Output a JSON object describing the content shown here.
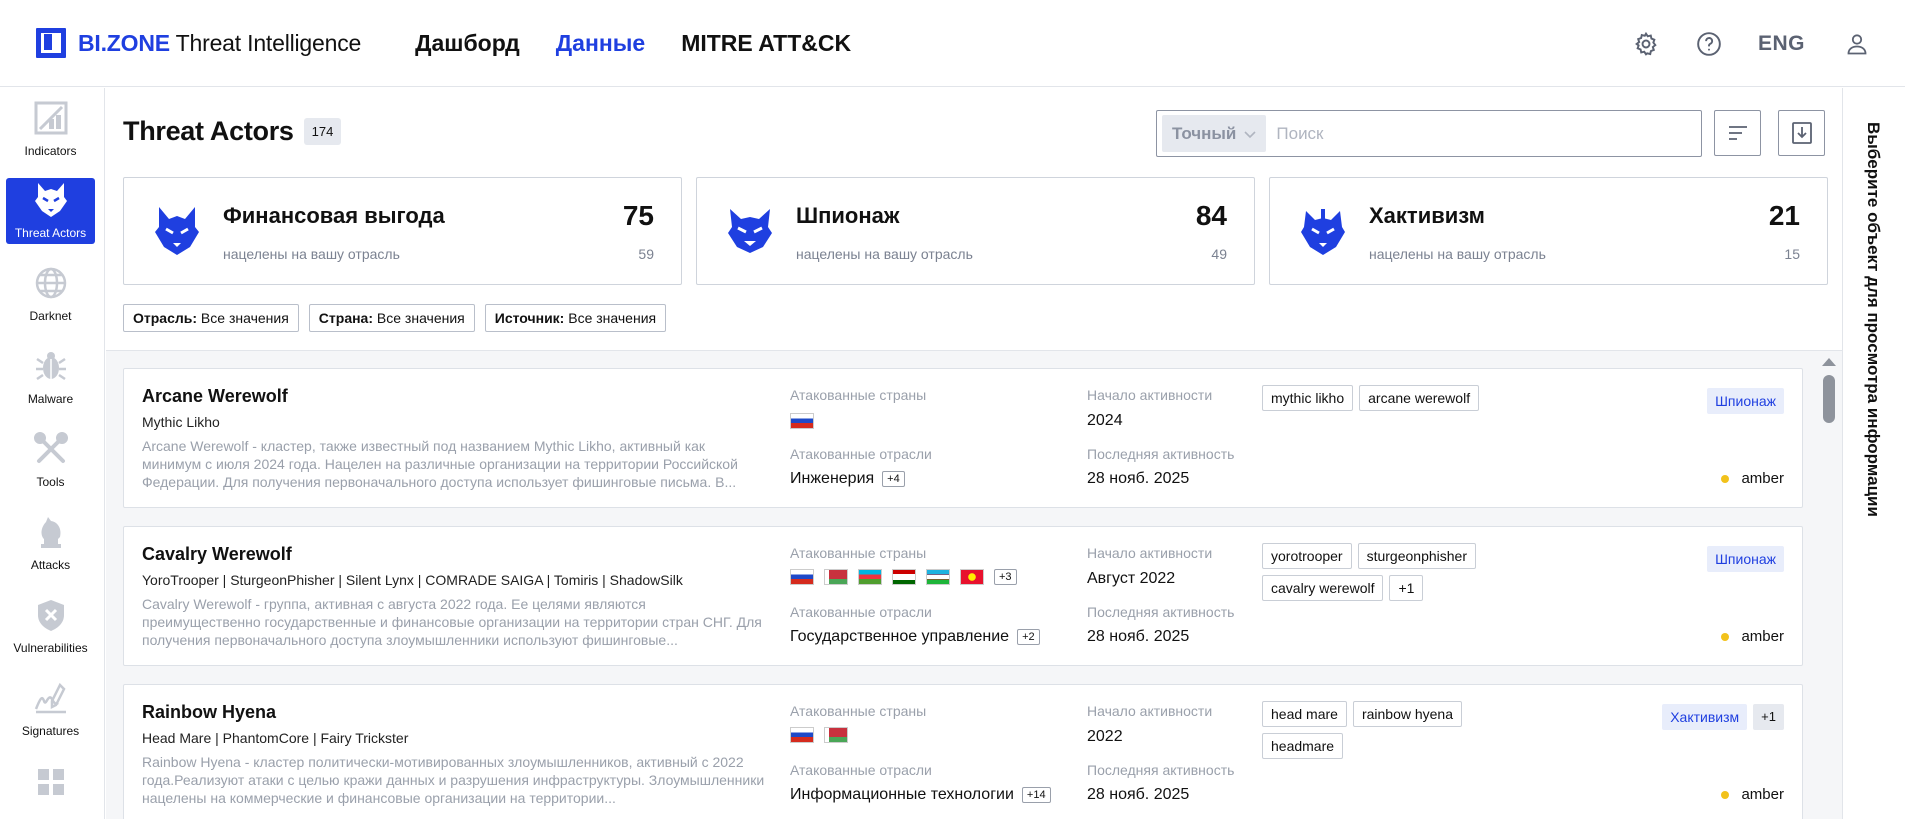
{
  "header": {
    "brand_prefix": "BI.ZONE",
    "brand_suffix": " Threat Intelligence",
    "nav": [
      {
        "label": "Дашборд"
      },
      {
        "label": "Данные"
      },
      {
        "label": "MITRE ATT&CK"
      }
    ],
    "active_nav": "Данные",
    "lang": "ENG"
  },
  "sidebar": {
    "items": [
      {
        "label": "Indicators",
        "icon": "indicators-icon"
      },
      {
        "label": "Threat Actors",
        "icon": "wolf-icon",
        "active": true
      },
      {
        "label": "Darknet",
        "icon": "globe-icon"
      },
      {
        "label": "Malware",
        "icon": "bug-icon"
      },
      {
        "label": "Tools",
        "icon": "tools-icon"
      },
      {
        "label": "Attacks",
        "icon": "knight-icon"
      },
      {
        "label": "Vulnerabilities",
        "icon": "shield-icon"
      },
      {
        "label": "Signatures",
        "icon": "signature-icon"
      }
    ]
  },
  "page": {
    "title": "Threat Actors",
    "count": "174",
    "search_mode": "Точный",
    "search_placeholder": "Поиск"
  },
  "categories": [
    {
      "title": "Финансовая выгода",
      "subtitle": "нацелены на вашу отрасль",
      "count": "75",
      "targeted": "59"
    },
    {
      "title": "Шпионаж",
      "subtitle": "нацелены на вашу отрасль",
      "count": "84",
      "targeted": "49"
    },
    {
      "title": "Хактивизм",
      "subtitle": "нацелены на вашу отрасль",
      "count": "21",
      "targeted": "15"
    }
  ],
  "filters": [
    {
      "key": "Отрасль:",
      "value": " Все значения"
    },
    {
      "key": "Страна:",
      "value": " Все значения"
    },
    {
      "key": "Источник:",
      "value": " Все значения"
    }
  ],
  "labels": {
    "countries": "Атакованные страны",
    "industries": "Атакованные отрасли",
    "start": "Начало активности",
    "last": "Последняя активность"
  },
  "actors": [
    {
      "name": "Arcane Werewolf",
      "aliases": "Mythic Likho",
      "description": "Arcane Werewolf - кластер, также известный под названием Mythic Likho, активный как минимум с июля 2024 года. Нацелен на различные организации на территории Российской Федерации. Для получения первоначального доступа использует фишинговые письма. В...",
      "flags": [
        "ru"
      ],
      "flags_more": "",
      "industry": "Инженерия",
      "industry_more": "+4",
      "start": "2024",
      "last": "28 нояб. 2025",
      "tags": [
        "mythic likho",
        "arcane werewolf"
      ],
      "motives": [
        "Шпионаж"
      ],
      "motive_more": "",
      "tlp": "amber"
    },
    {
      "name": "Cavalry Werewolf",
      "aliases": "YoroTrooper | SturgeonPhisher | Silent Lynx | COMRADE SAIGA | Tomiris | ShadowSilk",
      "description": "Cavalry Werewolf - группа, активная с августа 2022 года. Ее целями являются преимущественно государственные и финансовые организации на территории стран СНГ. Для получения первоначального доступа злоумышленники используют фишинговые...",
      "flags": [
        "ru",
        "by",
        "az",
        "tj",
        "uz",
        "kg"
      ],
      "flags_more": "+3",
      "industry": "Государственное управление",
      "industry_more": "+2",
      "start": "Август 2022",
      "last": "28 нояб. 2025",
      "tags": [
        "yorotrooper",
        "sturgeonphisher",
        "cavalry werewolf",
        "+1"
      ],
      "motives": [
        "Шпионаж"
      ],
      "motive_more": "",
      "tlp": "amber"
    },
    {
      "name": "Rainbow Hyena",
      "aliases": "Head Mare | PhantomCore | Fairy Trickster",
      "description": "Rainbow Hyena - кластер политически-мотивированных злоумышленников, активный с 2022 года.Реализуют атаки с целью кражи данных и разрушения инфраструктуры. Злоумышленники нацелены на коммерческие и финансовые организации на территории...",
      "flags": [
        "ru",
        "by"
      ],
      "flags_more": "",
      "industry": "Информационные технологии",
      "industry_more": "+14",
      "start": "2022",
      "last": "28 нояб. 2025",
      "tags": [
        "head mare",
        "rainbow hyena",
        "headmare"
      ],
      "motives": [
        "Хактивизм"
      ],
      "motive_more": "+1",
      "tlp": "amber"
    }
  ],
  "right_panel": {
    "hint": "Выберите объект для просмотра информации"
  },
  "colors": {
    "accent": "#1f3fe0",
    "amber": "#f2c21b",
    "muted": "#9aa0ab"
  }
}
